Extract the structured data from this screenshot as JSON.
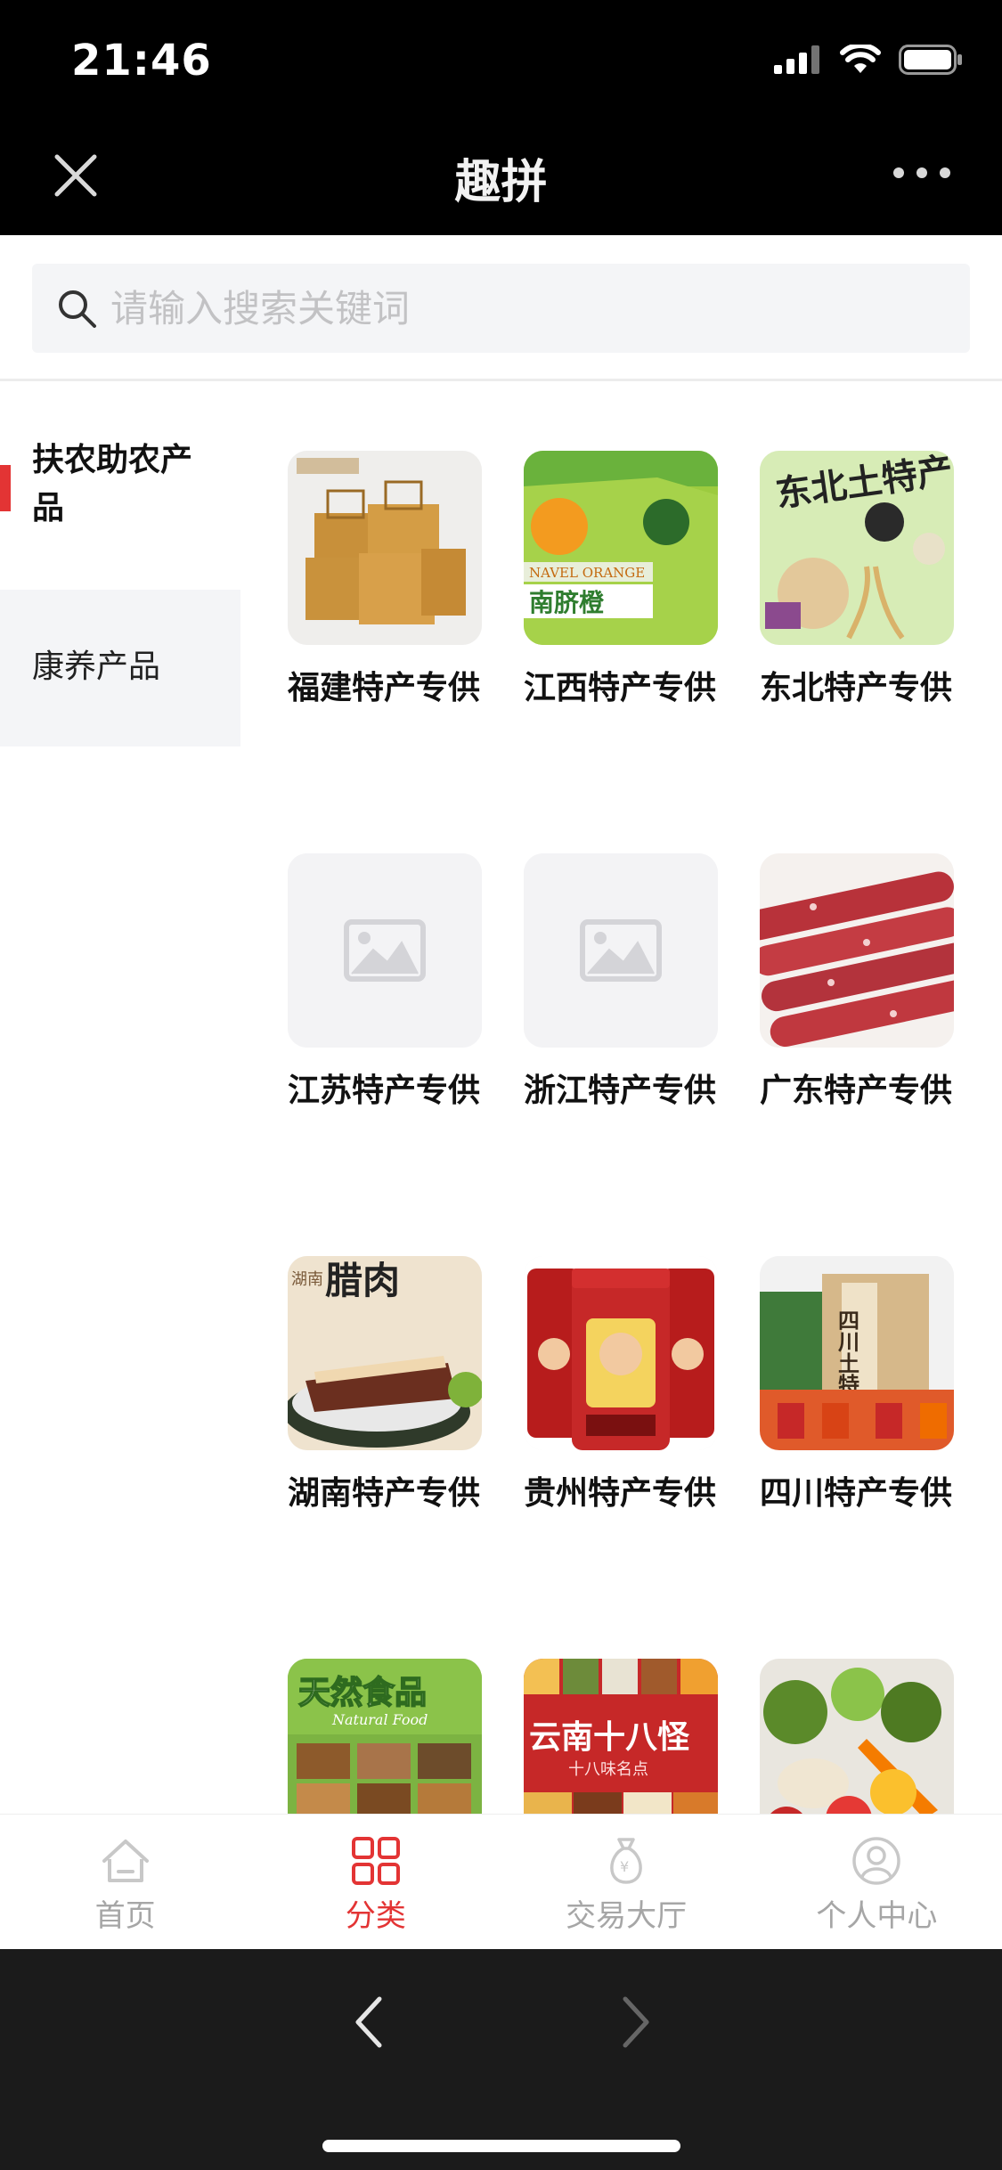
{
  "status": {
    "time": "21:46"
  },
  "nav": {
    "title": "趣拼"
  },
  "search": {
    "placeholder": "请输入搜索关键词"
  },
  "sidebar": {
    "items": [
      {
        "label": "扶农助农产品",
        "active": true
      },
      {
        "label": "康养产品",
        "active": false
      }
    ]
  },
  "products": [
    {
      "label": "福建特产专供",
      "image": "boxes"
    },
    {
      "label": "江西特产专供",
      "image": "orange-box"
    },
    {
      "label": "东北特产专供",
      "image": "northeast"
    },
    {
      "label": "江苏特产专供",
      "image": "placeholder"
    },
    {
      "label": "浙江特产专供",
      "image": "placeholder"
    },
    {
      "label": "广东特产专供",
      "image": "sausage"
    },
    {
      "label": "湖南特产专供",
      "image": "cured-meat"
    },
    {
      "label": "贵州特产专供",
      "image": "chili-jars"
    },
    {
      "label": "四川特产专供",
      "image": "sichuan-box"
    },
    {
      "label": "",
      "image": "natural-food"
    },
    {
      "label": "",
      "image": "yunnan"
    },
    {
      "label": "",
      "image": "vegetables"
    }
  ],
  "product_image_text": {
    "northeast": "东北土特产",
    "orange_box_banner": "NAVEL ORANGE",
    "orange_box_name": "南脐橙",
    "cured_meat_region": "湖南",
    "cured_meat_title": "腊肉",
    "sichuan_box": "四川土特产",
    "natural_food_cn": "天然食品",
    "natural_food_en": "Natural Food",
    "yunnan_title": "云南十八怪",
    "yunnan_sub": "十八味名点"
  },
  "tabbar": {
    "items": [
      {
        "label": "首页",
        "icon": "home-icon"
      },
      {
        "label": "分类",
        "icon": "grid-icon",
        "active": true
      },
      {
        "label": "交易大厅",
        "icon": "money-bag-icon"
      },
      {
        "label": "个人中心",
        "icon": "user-icon"
      }
    ]
  },
  "colors": {
    "accent": "#e33434",
    "tab_inactive": "#a6a6a6",
    "sidebar_bg": "#f4f5f7"
  }
}
